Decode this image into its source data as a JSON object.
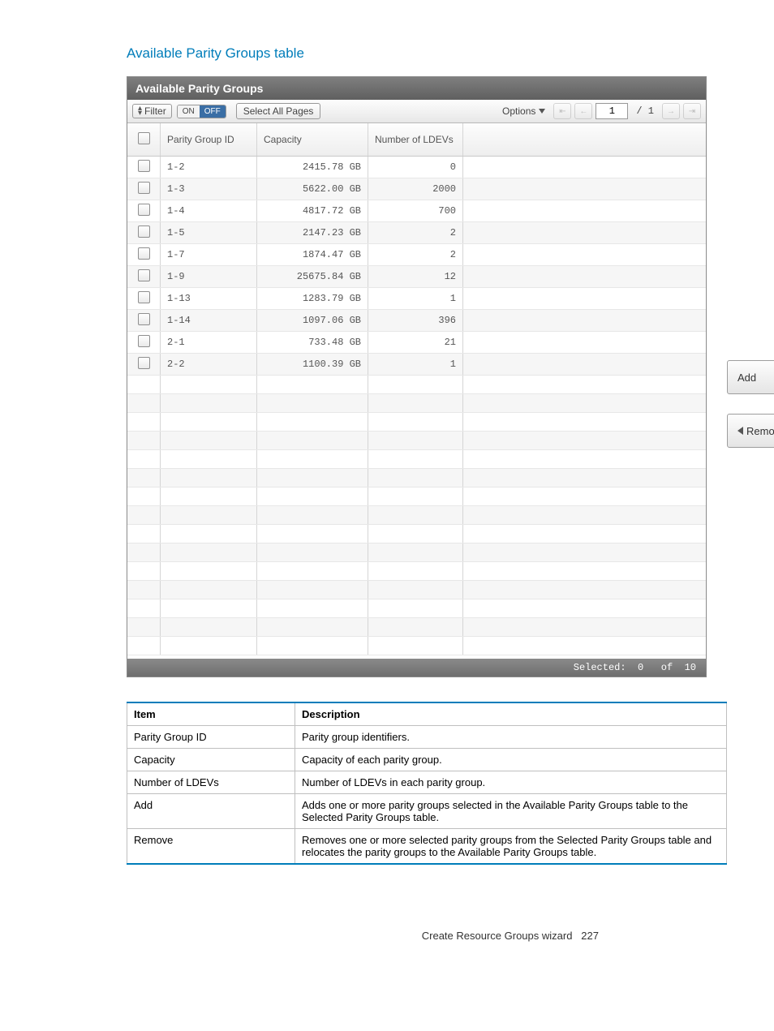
{
  "section_title": "Available Parity Groups table",
  "panel": {
    "title": "Available Parity Groups",
    "toolbar": {
      "filter_label": "Filter",
      "toggle_on": "ON",
      "toggle_off": "OFF",
      "select_all_label": "Select All Pages",
      "options_label": "Options",
      "page_current": "1",
      "page_total": "/ 1"
    },
    "columns": {
      "parity_group_id": "Parity Group ID",
      "capacity": "Capacity",
      "num_ldevs": "Number of LDEVs"
    },
    "rows": [
      {
        "id": "1-2",
        "capacity": "2415.78 GB",
        "ldevs": "0"
      },
      {
        "id": "1-3",
        "capacity": "5622.00 GB",
        "ldevs": "2000"
      },
      {
        "id": "1-4",
        "capacity": "4817.72 GB",
        "ldevs": "700"
      },
      {
        "id": "1-5",
        "capacity": "2147.23 GB",
        "ldevs": "2"
      },
      {
        "id": "1-7",
        "capacity": "1874.47 GB",
        "ldevs": "2"
      },
      {
        "id": "1-9",
        "capacity": "25675.84 GB",
        "ldevs": "12"
      },
      {
        "id": "1-13",
        "capacity": "1283.79 GB",
        "ldevs": "1"
      },
      {
        "id": "1-14",
        "capacity": "1097.06 GB",
        "ldevs": "396"
      },
      {
        "id": "2-1",
        "capacity": "733.48 GB",
        "ldevs": "21"
      },
      {
        "id": "2-2",
        "capacity": "1100.39 GB",
        "ldevs": "1"
      }
    ],
    "empty_row_count": 15,
    "footer": {
      "selected_label": "Selected:",
      "selected_count": "0",
      "of_label": "of",
      "total_count": "10"
    },
    "side_buttons": {
      "add": "Add",
      "remove": "Remo"
    }
  },
  "desc": {
    "headers": {
      "item": "Item",
      "description": "Description"
    },
    "rows": [
      {
        "item": "Parity Group ID",
        "desc": "Parity group identifiers."
      },
      {
        "item": "Capacity",
        "desc": "Capacity of each parity group."
      },
      {
        "item": "Number of LDEVs",
        "desc": "Number of LDEVs in each parity group."
      },
      {
        "item": "Add",
        "desc": "Adds one or more parity groups selected in the Available Parity Groups table to the Selected Parity Groups table."
      },
      {
        "item": "Remove",
        "desc": "Removes one or more selected parity groups from the Selected Parity Groups table and relocates the parity groups to the Available Parity Groups table."
      }
    ]
  },
  "page_footer": {
    "text": "Create Resource Groups wizard",
    "page_num": "227"
  }
}
